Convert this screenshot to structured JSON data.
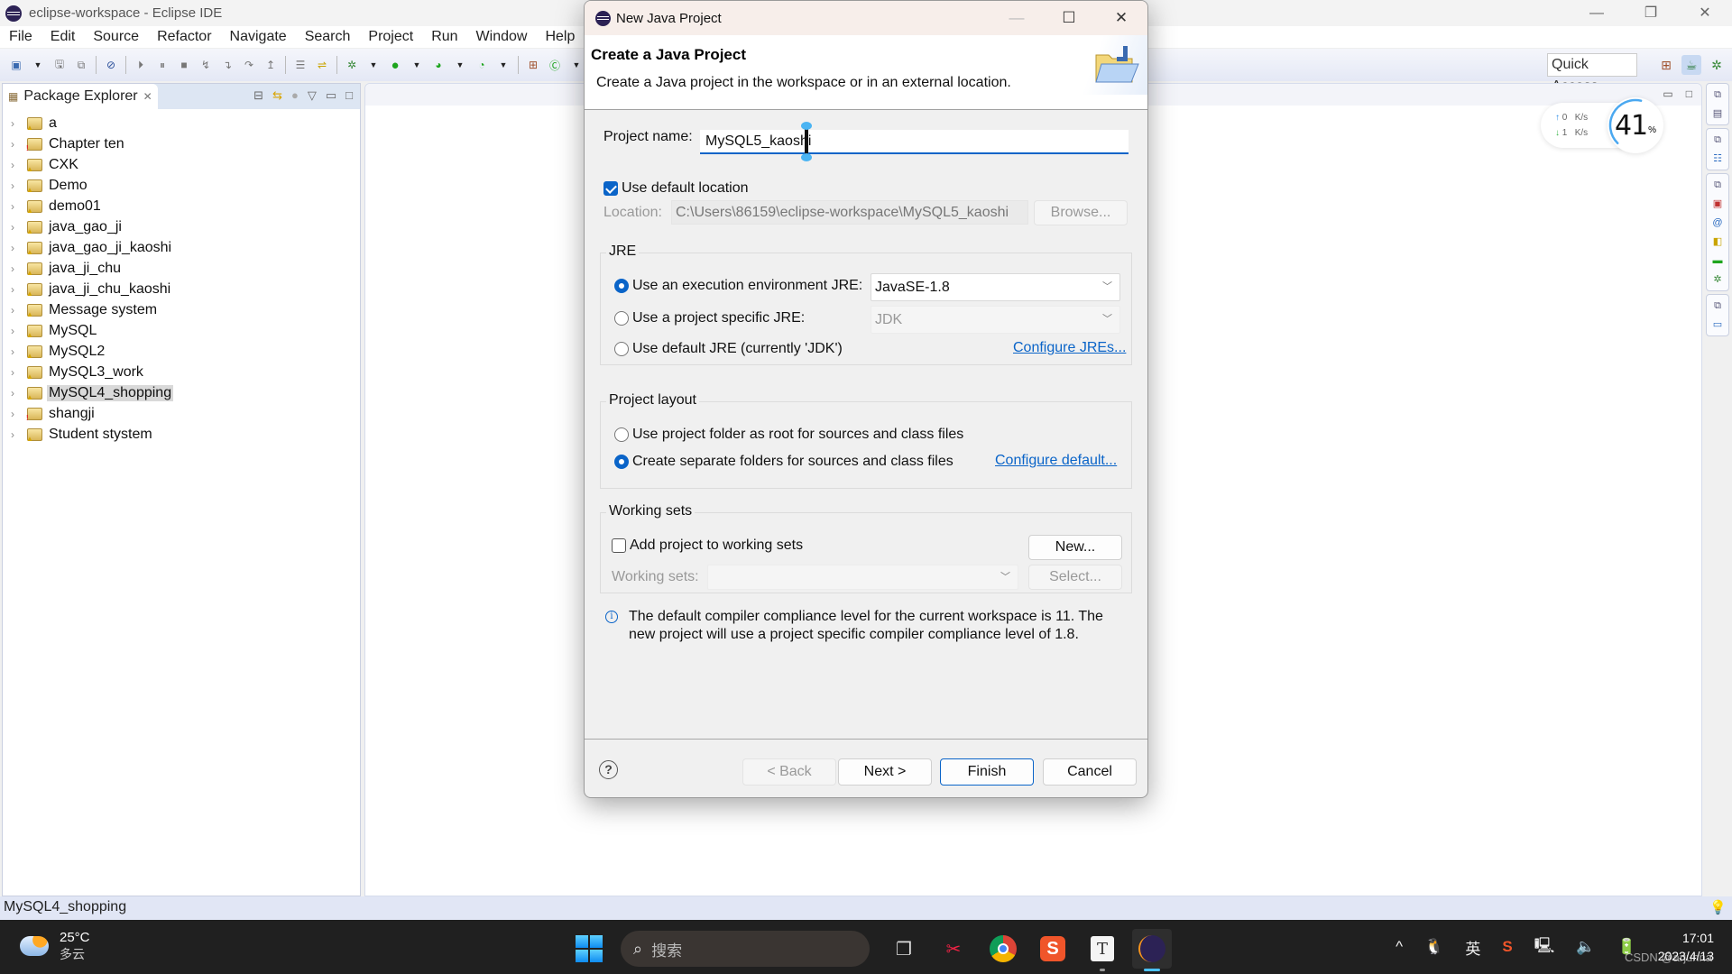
{
  "window": {
    "title": "eclipse-workspace - Eclipse IDE",
    "controls": {
      "minimize": "—",
      "restore": "❐",
      "close": "✕"
    }
  },
  "menubar": [
    "File",
    "Edit",
    "Source",
    "Refactor",
    "Navigate",
    "Search",
    "Project",
    "Run",
    "Window",
    "Help"
  ],
  "toolbar": {
    "quick_access": "Quick Access"
  },
  "package_explorer": {
    "tab_label": "Package Explorer",
    "projects": [
      {
        "name": "a",
        "marker": "warning"
      },
      {
        "name": "Chapter ten",
        "marker": "error"
      },
      {
        "name": "CXK",
        "marker": "warning"
      },
      {
        "name": "Demo",
        "marker": "warning"
      },
      {
        "name": "demo01",
        "marker": "warning"
      },
      {
        "name": "java_gao_ji",
        "marker": "warning"
      },
      {
        "name": "java_gao_ji_kaoshi",
        "marker": "warning"
      },
      {
        "name": "java_ji_chu",
        "marker": "warning"
      },
      {
        "name": "java_ji_chu_kaoshi",
        "marker": "warning"
      },
      {
        "name": "Message system",
        "marker": "warning"
      },
      {
        "name": "MySQL",
        "marker": "warning"
      },
      {
        "name": "MySQL2",
        "marker": "warning"
      },
      {
        "name": "MySQL3_work",
        "marker": "warning"
      },
      {
        "name": "MySQL4_shopping",
        "marker": "warning",
        "selected": true
      },
      {
        "name": "shangji",
        "marker": "error"
      },
      {
        "name": "Student stystem",
        "marker": "warning"
      }
    ]
  },
  "network_widget": {
    "upload": "0",
    "download": "1",
    "unit": "K/s",
    "load_percent": 41,
    "load_percent_label": "41",
    "percent_sign": "%"
  },
  "statusbar": {
    "selection": "MySQL4_shopping"
  },
  "dialog": {
    "title": "New Java Project",
    "header_title": "Create a Java Project",
    "header_desc": "Create a Java project in the workspace or in an external location.",
    "project_name_label": "Project name:",
    "project_name_value": "MySQL5_kaoshi",
    "use_default_location_label": "Use default location",
    "use_default_location_checked": true,
    "location_label": "Location:",
    "location_value": "C:\\Users\\86159\\eclipse-workspace\\MySQL5_kaoshi",
    "browse_label": "Browse...",
    "jre": {
      "group_title": "JRE",
      "option_exec_env": "Use an execution environment JRE:",
      "exec_env_value": "JavaSE-1.8",
      "option_project_specific": "Use a project specific JRE:",
      "project_specific_value": "JDK",
      "option_default": "Use default JRE (currently 'JDK')",
      "configure_link": "Configure JREs...",
      "selected": "exec_env"
    },
    "layout": {
      "group_title": "Project layout",
      "option_root": "Use project folder as root for sources and class files",
      "option_separate": "Create separate folders for sources and class files",
      "configure_link": "Configure default...",
      "selected": "separate"
    },
    "working_sets": {
      "group_title": "Working sets",
      "add_label": "Add project to working sets",
      "add_checked": false,
      "new_label": "New...",
      "sets_label": "Working sets:",
      "sets_value": "",
      "select_label": "Select..."
    },
    "info_message": "The default compiler compliance level for the current workspace is 11. The new project will use a project specific compiler compliance level of 1.8.",
    "buttons": {
      "back": "< Back",
      "next": "Next >",
      "finish": "Finish",
      "cancel": "Cancel"
    }
  },
  "taskbar": {
    "weather_temp": "25°C",
    "weather_cond": "多云",
    "search_placeholder": "搜索",
    "ime": "英",
    "time": "17:01",
    "date": "2023/4/13",
    "watermark": "CSDN @arjunna"
  },
  "colors": {
    "accent": "#0a64c8",
    "taskbar_bg": "#202020",
    "status_bg": "#e1e6f5"
  }
}
